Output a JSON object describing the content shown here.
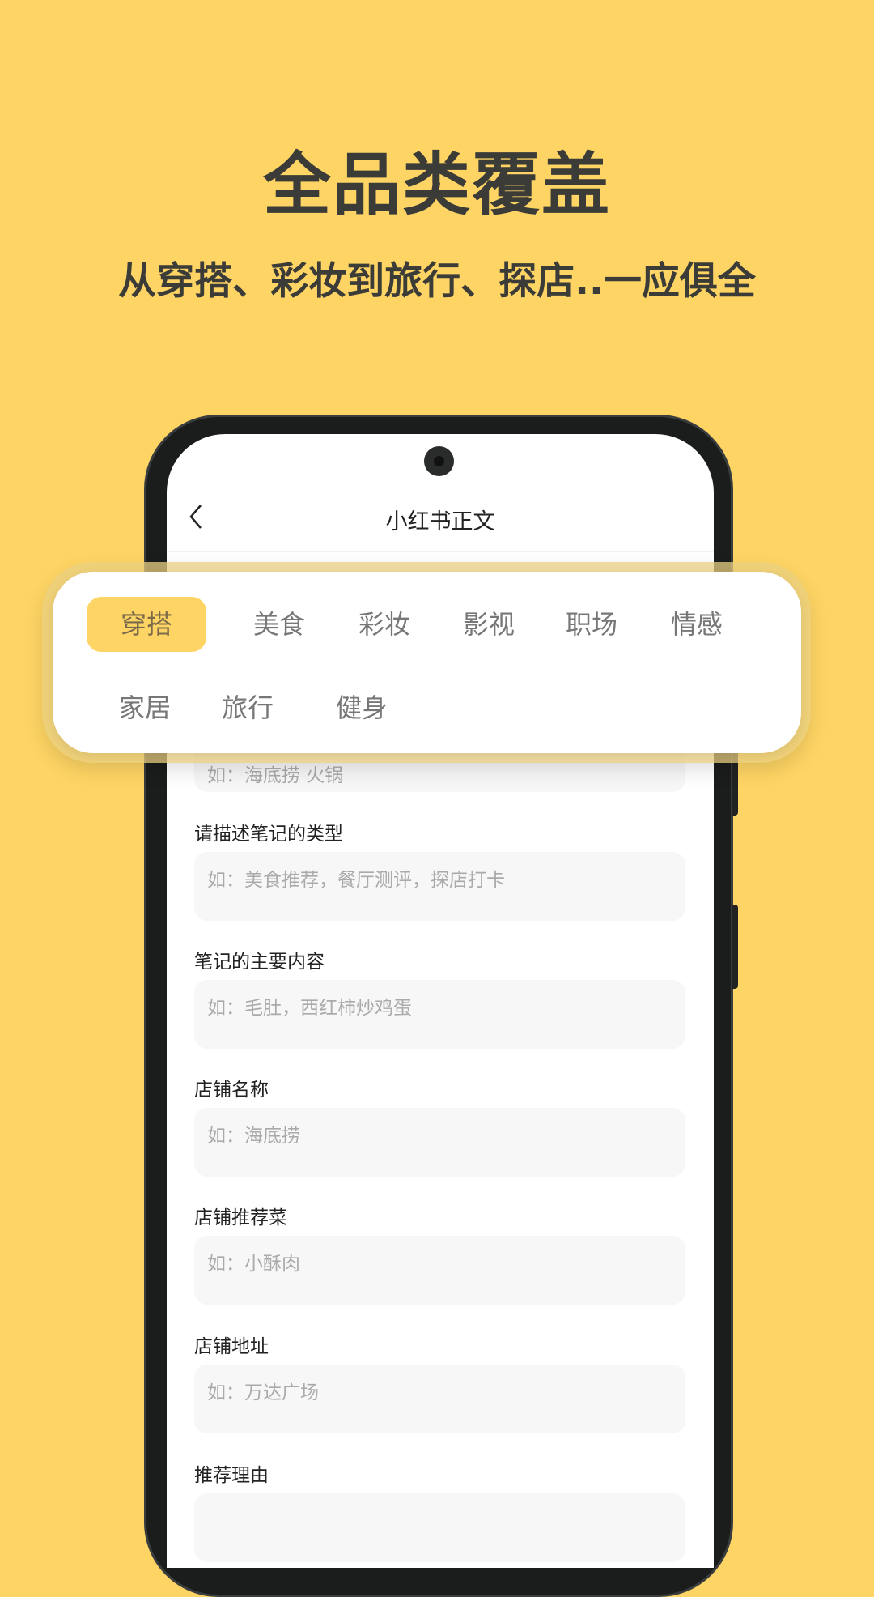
{
  "promo": {
    "title": "全品类覆盖",
    "subtitle": "从穿搭、彩妆到旅行、探店..一应俱全"
  },
  "app": {
    "nav_title": "小红书正文",
    "back_icon": "chevron-left-icon",
    "hidden_field_placeholder": "如：海底捞 火锅",
    "fields": [
      {
        "label": "请描述笔记的类型",
        "placeholder": "如：美食推荐，餐厅测评，探店打卡"
      },
      {
        "label": "笔记的主要内容",
        "placeholder": "如：毛肚，西红柿炒鸡蛋"
      },
      {
        "label": "店铺名称",
        "placeholder": "如：海底捞"
      },
      {
        "label": "店铺推荐菜",
        "placeholder": "如：小酥肉"
      },
      {
        "label": "店铺地址",
        "placeholder": "如：万达广场"
      },
      {
        "label": "推荐理由",
        "placeholder": ""
      }
    ]
  },
  "categories": {
    "selected": "穿搭",
    "items": [
      "穿搭",
      "美食",
      "彩妆",
      "影视",
      "职场",
      "情感",
      "家居",
      "旅行",
      "健身"
    ]
  },
  "colors": {
    "background": "#FED564",
    "accent": "#FED564",
    "text_dark": "#3b3b38"
  }
}
